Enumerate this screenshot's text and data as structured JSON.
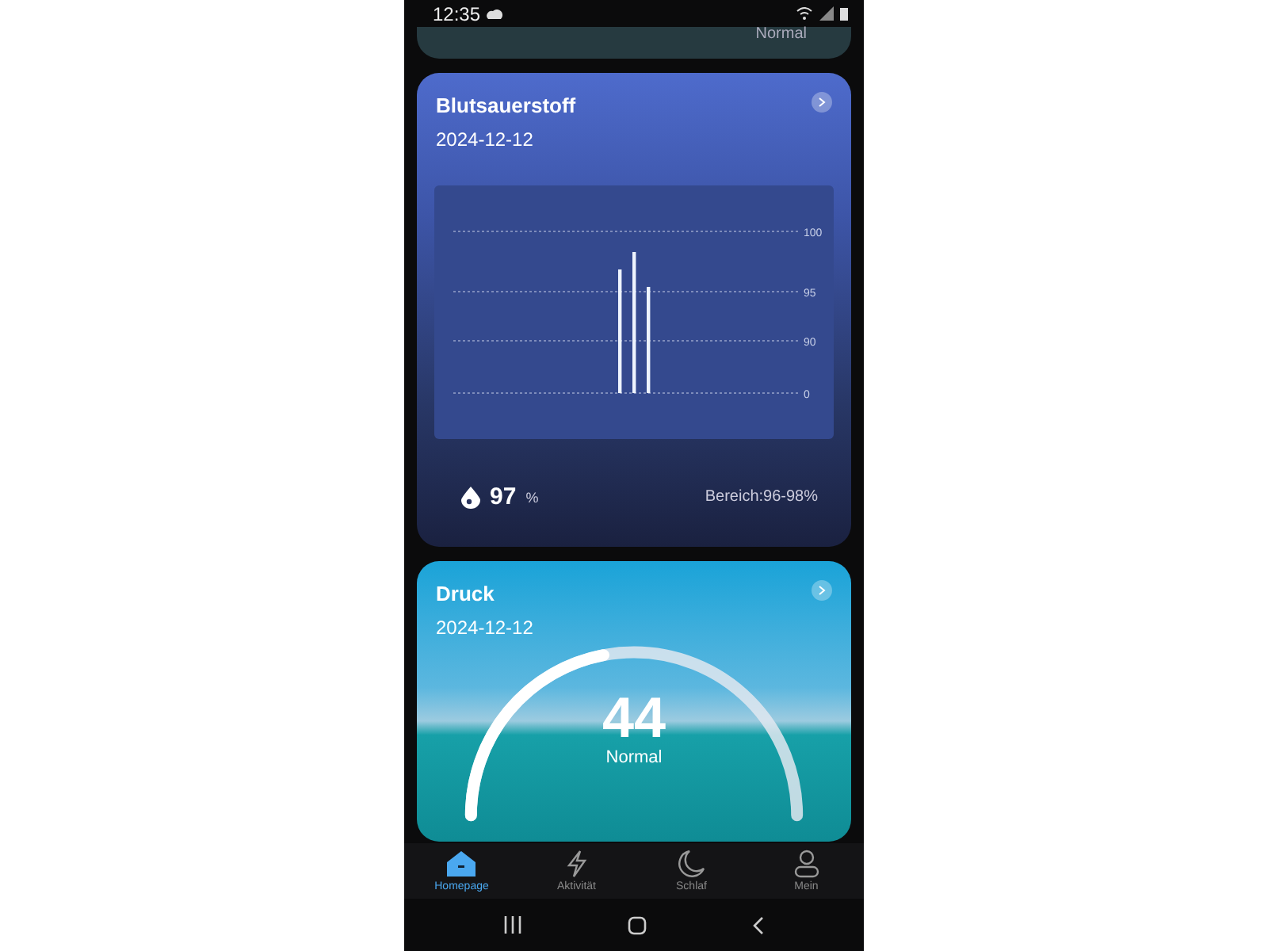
{
  "status_bar": {
    "time": "12:35"
  },
  "previous_card": {
    "status": "Normal"
  },
  "oxygen_card": {
    "title": "Blutsauerstoff",
    "date": "2024-12-12",
    "chart_axis_labels": [
      "100",
      "95",
      "90",
      "0"
    ],
    "value": "97",
    "unit": "%",
    "range": "Bereich:96-98%"
  },
  "pressure_card": {
    "title": "Druck",
    "date": "2024-12-12",
    "value": "44",
    "status": "Normal",
    "level": 0.44
  },
  "bottom_nav": [
    {
      "label": "Homepage",
      "kind": "home",
      "selected": true
    },
    {
      "label": "Aktivität",
      "kind": "bolt",
      "selected": false
    },
    {
      "label": "Schlaf",
      "kind": "moon",
      "selected": false
    },
    {
      "label": "Mein",
      "kind": "person",
      "selected": false
    }
  ]
}
